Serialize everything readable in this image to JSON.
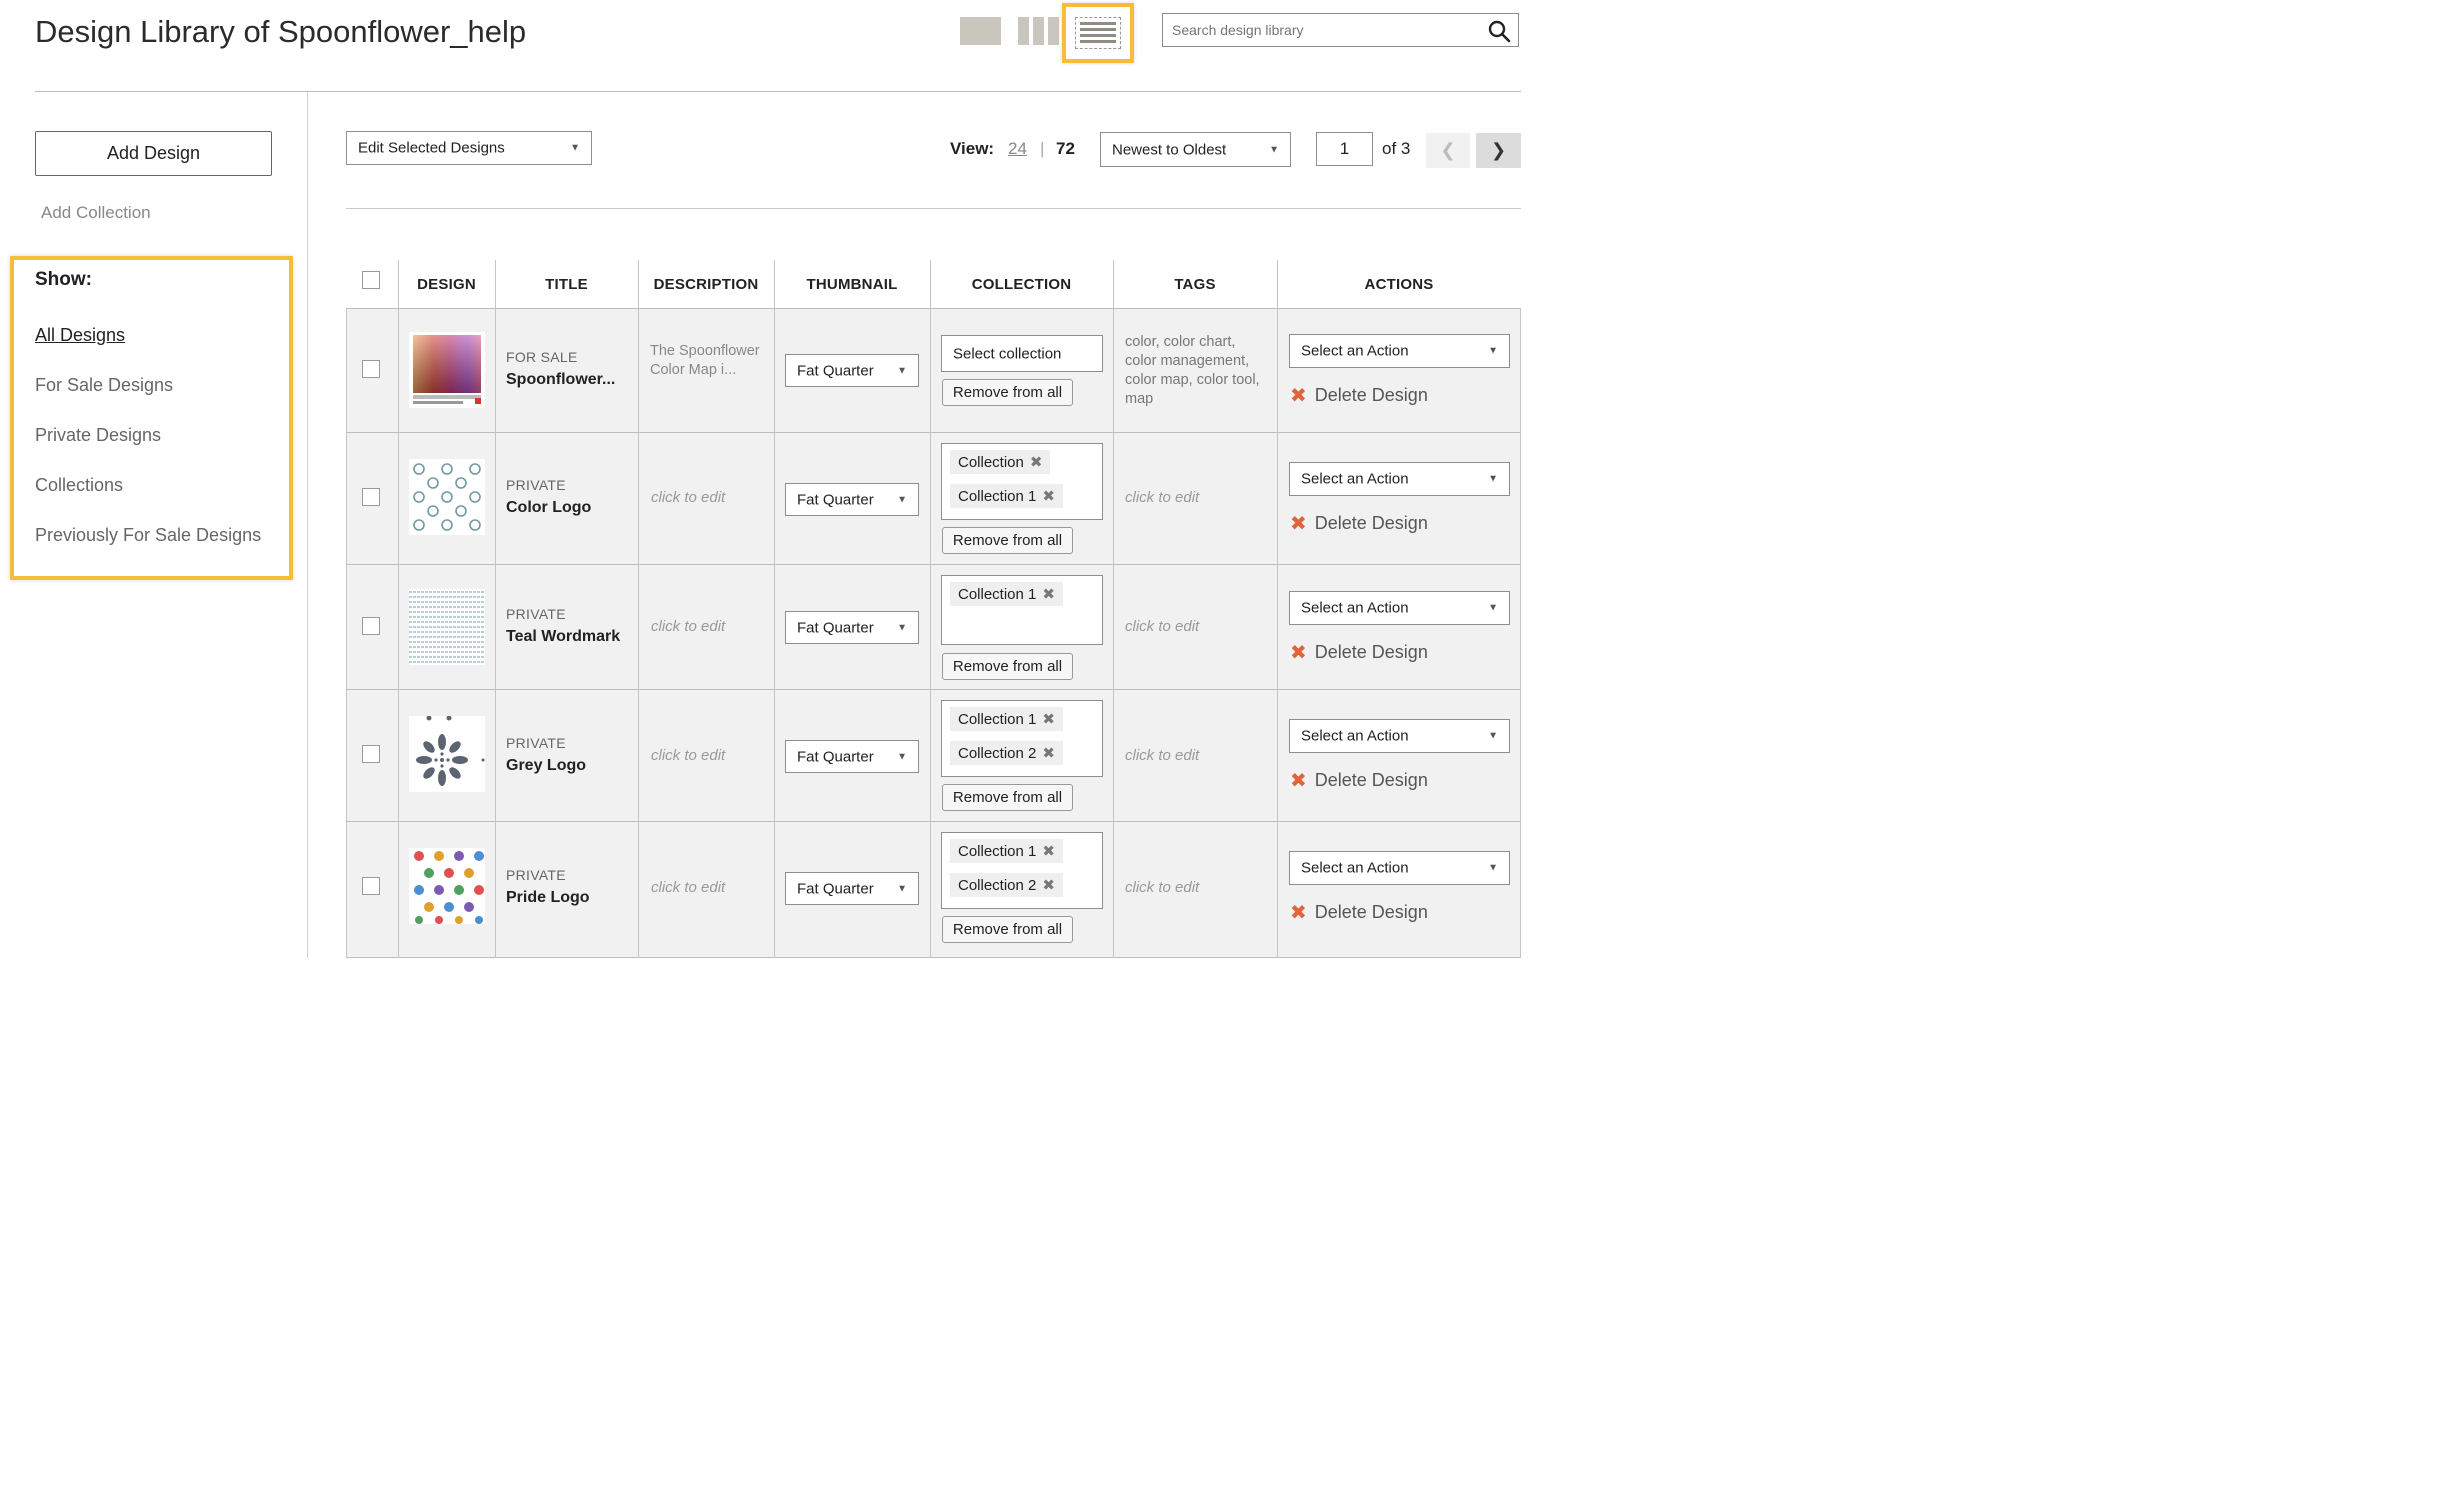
{
  "page": {
    "title": "Design Library of Spoonflower_help",
    "search_placeholder": "Search design library"
  },
  "sidebar": {
    "add_design": "Add Design",
    "add_collection": "Add Collection",
    "show_label": "Show:",
    "items": [
      {
        "label": "All Designs",
        "active": true
      },
      {
        "label": "For Sale Designs"
      },
      {
        "label": "Private Designs"
      },
      {
        "label": "Collections"
      },
      {
        "label": "Previously For Sale Designs"
      }
    ]
  },
  "toolbar": {
    "edit_selected": "Edit Selected Designs",
    "view_label": "View:",
    "view_options": [
      "24",
      "72"
    ],
    "view_separator": "|",
    "sort": "Newest to Oldest",
    "page_current": "1",
    "page_of": "of 3"
  },
  "table": {
    "headers": [
      "DESIGN",
      "TITLE",
      "DESCRIPTION",
      "THUMBNAIL",
      "COLLECTION",
      "TAGS",
      "ACTIONS"
    ],
    "rows": [
      {
        "status": "FOR SALE",
        "title": "Spoonflower...",
        "description": "The Spoonflower Color Map i...",
        "thumbnail": "Fat Quarter",
        "collections": [],
        "collection_select": "Select collection",
        "remove_all": "Remove from all",
        "tags": "color, color chart, color management, color map, color tool, map",
        "action_select": "Select an Action",
        "delete": "Delete Design"
      },
      {
        "status": "PRIVATE",
        "title": "Color Logo",
        "description": "click to edit",
        "thumbnail": "Fat Quarter",
        "collections": [
          "Collection",
          "Collection 1"
        ],
        "remove_all": "Remove from all",
        "tags": "click to edit",
        "action_select": "Select an Action",
        "delete": "Delete Design"
      },
      {
        "status": "PRIVATE",
        "title": "Teal Wordmark",
        "description": "click to edit",
        "thumbnail": "Fat Quarter",
        "collections": [
          "Collection 1"
        ],
        "remove_all": "Remove from all",
        "tags": "click to edit",
        "action_select": "Select an Action",
        "delete": "Delete Design"
      },
      {
        "status": "PRIVATE",
        "title": "Grey Logo",
        "description": "click to edit",
        "thumbnail": "Fat Quarter",
        "collections": [
          "Collection 1",
          "Collection 2"
        ],
        "remove_all": "Remove from all",
        "tags": "click to edit",
        "action_select": "Select an Action",
        "delete": "Delete Design"
      },
      {
        "status": "PRIVATE",
        "title": "Pride Logo",
        "description": "click to edit",
        "thumbnail": "Fat Quarter",
        "collections": [
          "Collection 1",
          "Collection 2"
        ],
        "remove_all": "Remove from all",
        "tags": "click to edit",
        "action_select": "Select an Action",
        "delete": "Delete Design"
      }
    ]
  },
  "icons": {
    "search": "search-icon",
    "close": "close-icon",
    "chevron_left": "chevron-left-icon",
    "chevron_right": "chevron-right-icon",
    "dropdown": "chevron-down-icon"
  },
  "colors": {
    "highlight": "#f6bd3a",
    "delete_x": "#e0653b",
    "row_bg": "#f1f1f1"
  }
}
